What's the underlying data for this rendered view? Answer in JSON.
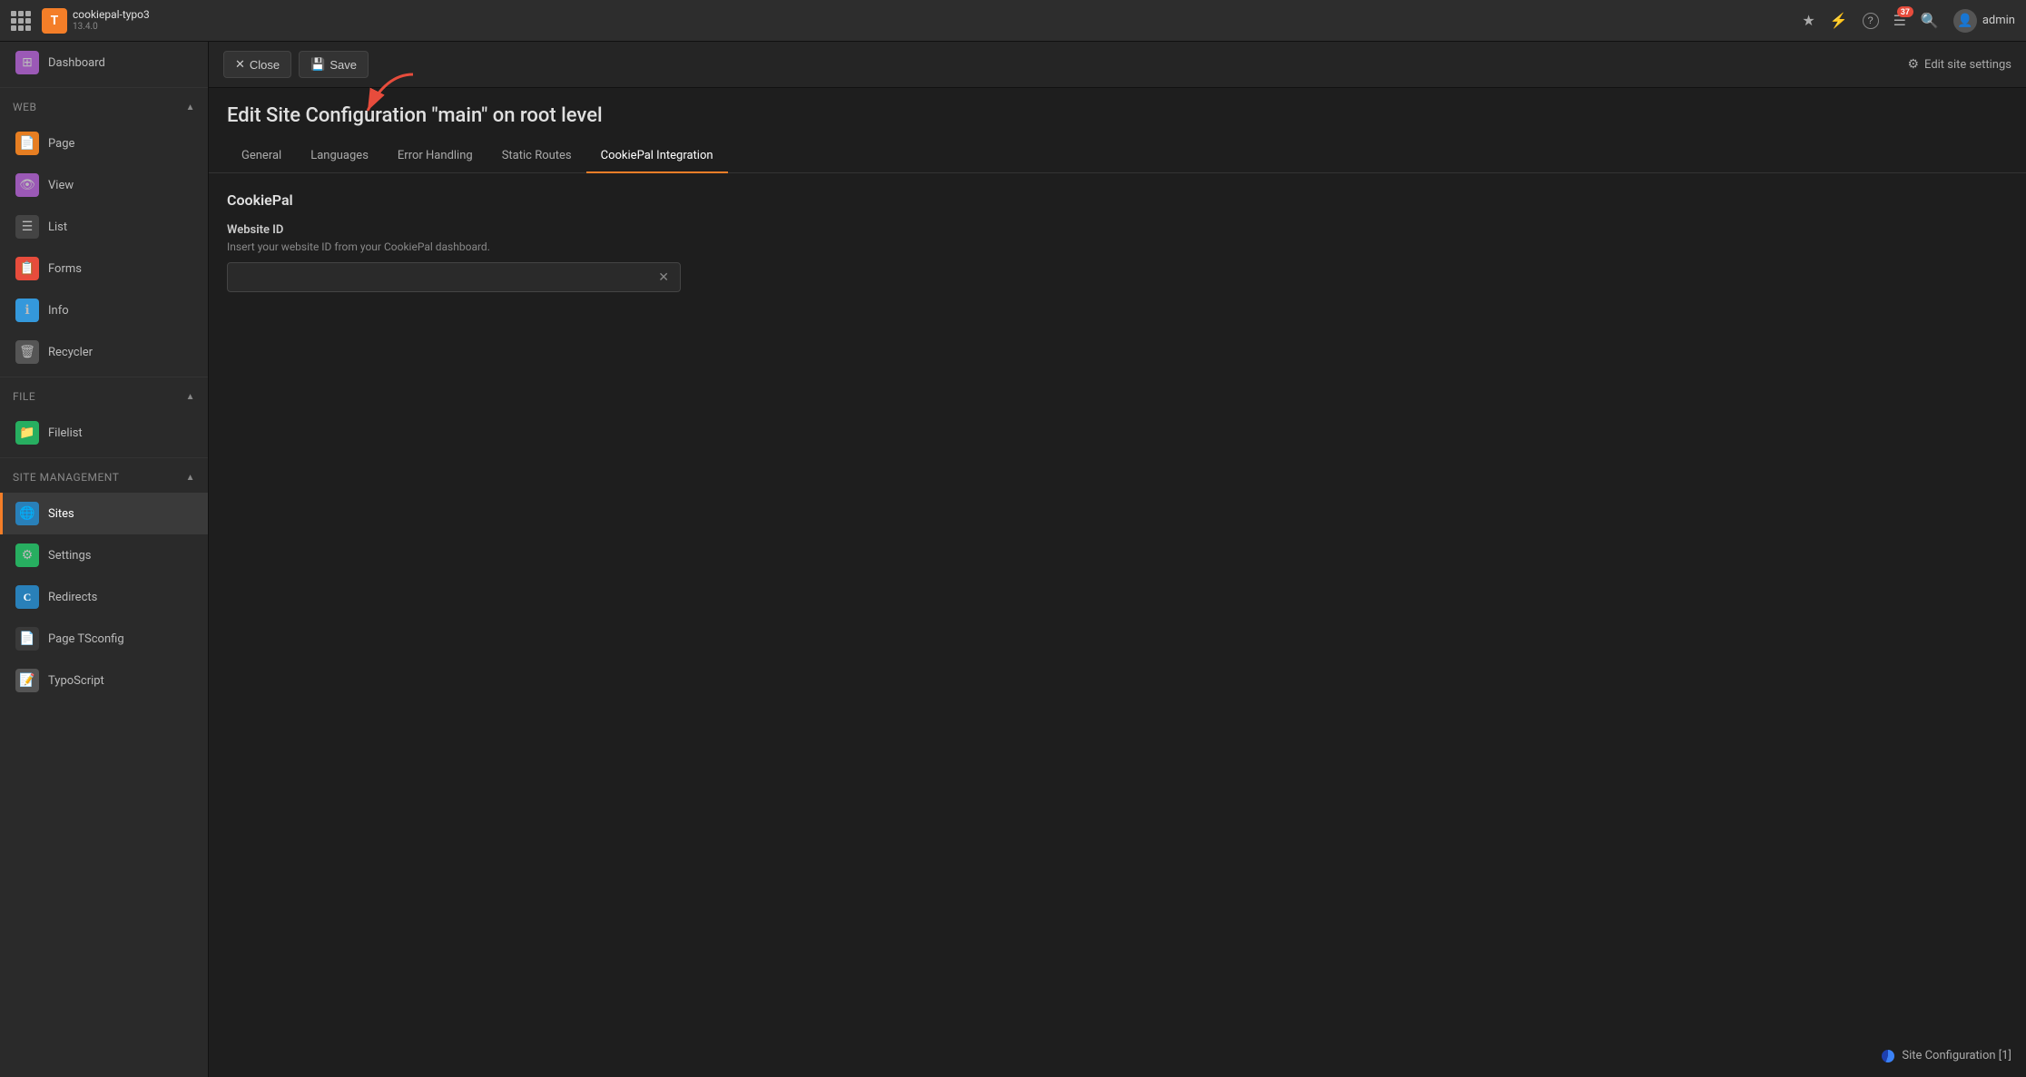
{
  "topbar": {
    "app_name": "cookiepal-typo3",
    "version": "13.4.0",
    "logo_letter": "T",
    "notification_count": "37",
    "username": "admin",
    "icons": {
      "star": "☆",
      "bolt": "⚡",
      "question": "?",
      "list": "☰",
      "search": "🔍"
    }
  },
  "sidebar": {
    "sections": [
      {
        "label": "Web",
        "collapsible": true,
        "expanded": true,
        "items": [
          {
            "id": "page",
            "label": "Page",
            "icon": "📄",
            "color": "#e67e22",
            "active": false
          },
          {
            "id": "view",
            "label": "View",
            "icon": "👁",
            "color": "#9b59b6",
            "active": false
          },
          {
            "id": "list",
            "label": "List",
            "icon": "☰",
            "color": "#3a3a3a",
            "active": false
          },
          {
            "id": "forms",
            "label": "Forms",
            "icon": "📋",
            "color": "#e74c3c",
            "active": false
          },
          {
            "id": "info",
            "label": "Info",
            "icon": "ℹ",
            "color": "#3498db",
            "active": false
          },
          {
            "id": "recycler",
            "label": "Recycler",
            "icon": "🗑",
            "color": "#555",
            "active": false
          }
        ]
      },
      {
        "label": "File",
        "collapsible": true,
        "expanded": true,
        "items": [
          {
            "id": "filelist",
            "label": "Filelist",
            "icon": "📁",
            "color": "#27ae60",
            "active": false
          }
        ]
      },
      {
        "label": "Site Management",
        "collapsible": true,
        "expanded": true,
        "items": [
          {
            "id": "sites",
            "label": "Sites",
            "icon": "🌐",
            "color": "#2980b9",
            "active": true
          },
          {
            "id": "settings",
            "label": "Settings",
            "icon": "⚙",
            "color": "#27ae60",
            "active": false
          },
          {
            "id": "redirects",
            "label": "Redirects",
            "icon": "C",
            "color": "#2980b9",
            "active": false
          },
          {
            "id": "pagetsconfig",
            "label": "Page TSconfig",
            "icon": "📄",
            "color": "#3a3a3a",
            "active": false
          },
          {
            "id": "typoscript",
            "label": "TypoScript",
            "icon": "📝",
            "color": "#555",
            "active": false
          }
        ]
      }
    ],
    "dashboard_label": "Dashboard"
  },
  "toolbar": {
    "close_label": "Close",
    "save_label": "Save",
    "edit_site_settings_label": "Edit site settings"
  },
  "page": {
    "title": "Edit Site Configuration \"main\" on root level"
  },
  "tabs": [
    {
      "id": "general",
      "label": "General",
      "active": false
    },
    {
      "id": "languages",
      "label": "Languages",
      "active": false
    },
    {
      "id": "error_handling",
      "label": "Error Handling",
      "active": false
    },
    {
      "id": "static_routes",
      "label": "Static Routes",
      "active": false
    },
    {
      "id": "cookiepal_integration",
      "label": "CookiePal Integration",
      "active": true
    }
  ],
  "cookiepal_section": {
    "title": "CookiePal",
    "website_id_label": "Website ID",
    "website_id_description": "Insert your website ID from your CookiePal dashboard.",
    "website_id_value": "",
    "website_id_placeholder": ""
  },
  "status": {
    "label": "Site Configuration",
    "count": "[1]"
  }
}
